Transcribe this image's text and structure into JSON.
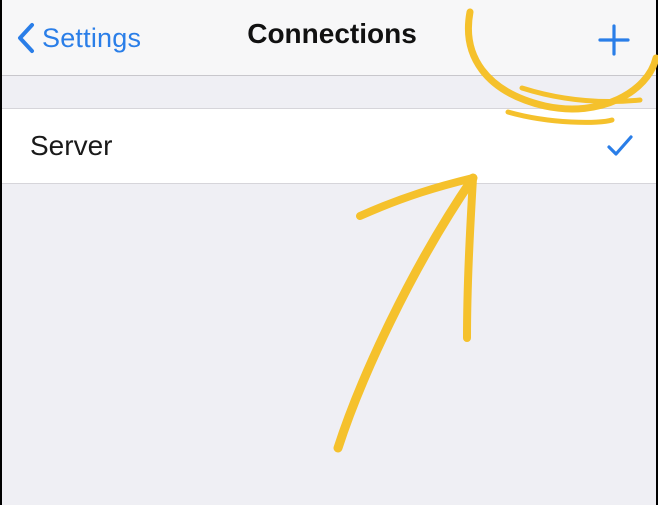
{
  "navbar": {
    "back_label": "Settings",
    "title": "Connections",
    "add_icon": "plus-icon"
  },
  "connections": {
    "rows": [
      {
        "label": "Server",
        "selected": true
      }
    ]
  },
  "colors": {
    "accent": "#2a7ee8",
    "annotation": "#f5c12c",
    "background": "#efeff4"
  }
}
